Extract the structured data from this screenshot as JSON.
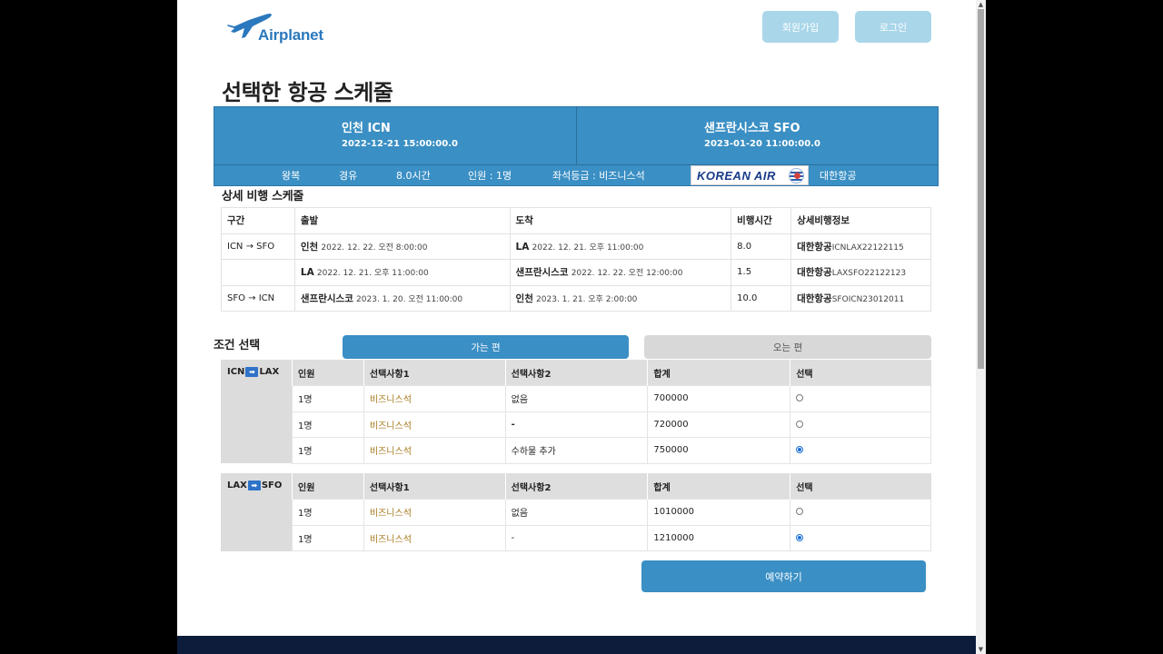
{
  "header": {
    "logo_text": "Airplanet",
    "signup_label": "회원가입",
    "login_label": "로그인"
  },
  "page_title": "선택한 항공 스케줄",
  "summary": {
    "departure_city": "인천 ICN",
    "departure_datetime": "2022-12-21 15:00:00.0",
    "arrival_city": "샌프란시스코 SFO",
    "arrival_datetime": "2023-01-20 11:00:00.0",
    "trip_type": "왕복",
    "stops": "경유",
    "duration": "8.0시간",
    "passengers": "인원 : 1명",
    "seat_class": "좌석등급 : 비즈니스석",
    "airline_logo": "KOREAN AIR",
    "airline_name": "대한항공"
  },
  "detail": {
    "title": "상세 비행 스케줄",
    "headers": [
      "구간",
      "출발",
      "도착",
      "비행시간",
      "상세비행정보"
    ],
    "rows": [
      {
        "segment": "ICN → SFO",
        "dep_place": "인천",
        "dep_time": "2022. 12. 22. 오전 8:00:00",
        "arr_place": "LA",
        "arr_time": "2022. 12. 21. 오후 11:00:00",
        "duration": "8.0",
        "airline": "대한항공",
        "code": "ICNLAX22122115"
      },
      {
        "segment": "",
        "dep_place": "LA",
        "dep_time": "2022. 12. 21. 오후 11:00:00",
        "arr_place": "샌프란시스코",
        "arr_time": "2022. 12. 22. 오전 12:00:00",
        "duration": "1.5",
        "airline": "대한항공",
        "code": "LAXSFO22122123"
      },
      {
        "segment": "SFO → ICN",
        "dep_place": "샌프란시스코",
        "dep_time": "2023. 1. 20. 오전 11:00:00",
        "arr_place": "인천",
        "arr_time": "2023. 1. 21. 오후 2:00:00",
        "duration": "10.0",
        "airline": "대한항공",
        "code": "SFOICN23012011"
      }
    ]
  },
  "conditions": {
    "title": "조건 선택",
    "tab_outbound": "가는 편",
    "tab_inbound": "오는 편"
  },
  "options": {
    "headers": [
      "인원",
      "선택사항1",
      "선택사항2",
      "합계",
      "선택"
    ],
    "groups": [
      {
        "from": "ICN",
        "to": "LAX",
        "arrow": "➡",
        "rows": [
          {
            "people": "1명",
            "option1": "비즈니스석",
            "option2": "없음",
            "total": "700000",
            "checked": false
          },
          {
            "people": "1명",
            "option1": "비즈니스석",
            "option2": "-",
            "total": "720000",
            "checked": false
          },
          {
            "people": "1명",
            "option1": "비즈니스석",
            "option2": "수하물 추가",
            "total": "750000",
            "checked": true
          }
        ]
      },
      {
        "from": "LAX",
        "to": "SFO",
        "arrow": "➡",
        "rows": [
          {
            "people": "1명",
            "option1": "비즈니스석",
            "option2": "없음",
            "total": "1010000",
            "checked": false
          },
          {
            "people": "1명",
            "option1": "비즈니스석",
            "option2": "-",
            "total": "1210000",
            "checked": true
          }
        ]
      }
    ]
  },
  "reserve_label": "예약하기"
}
